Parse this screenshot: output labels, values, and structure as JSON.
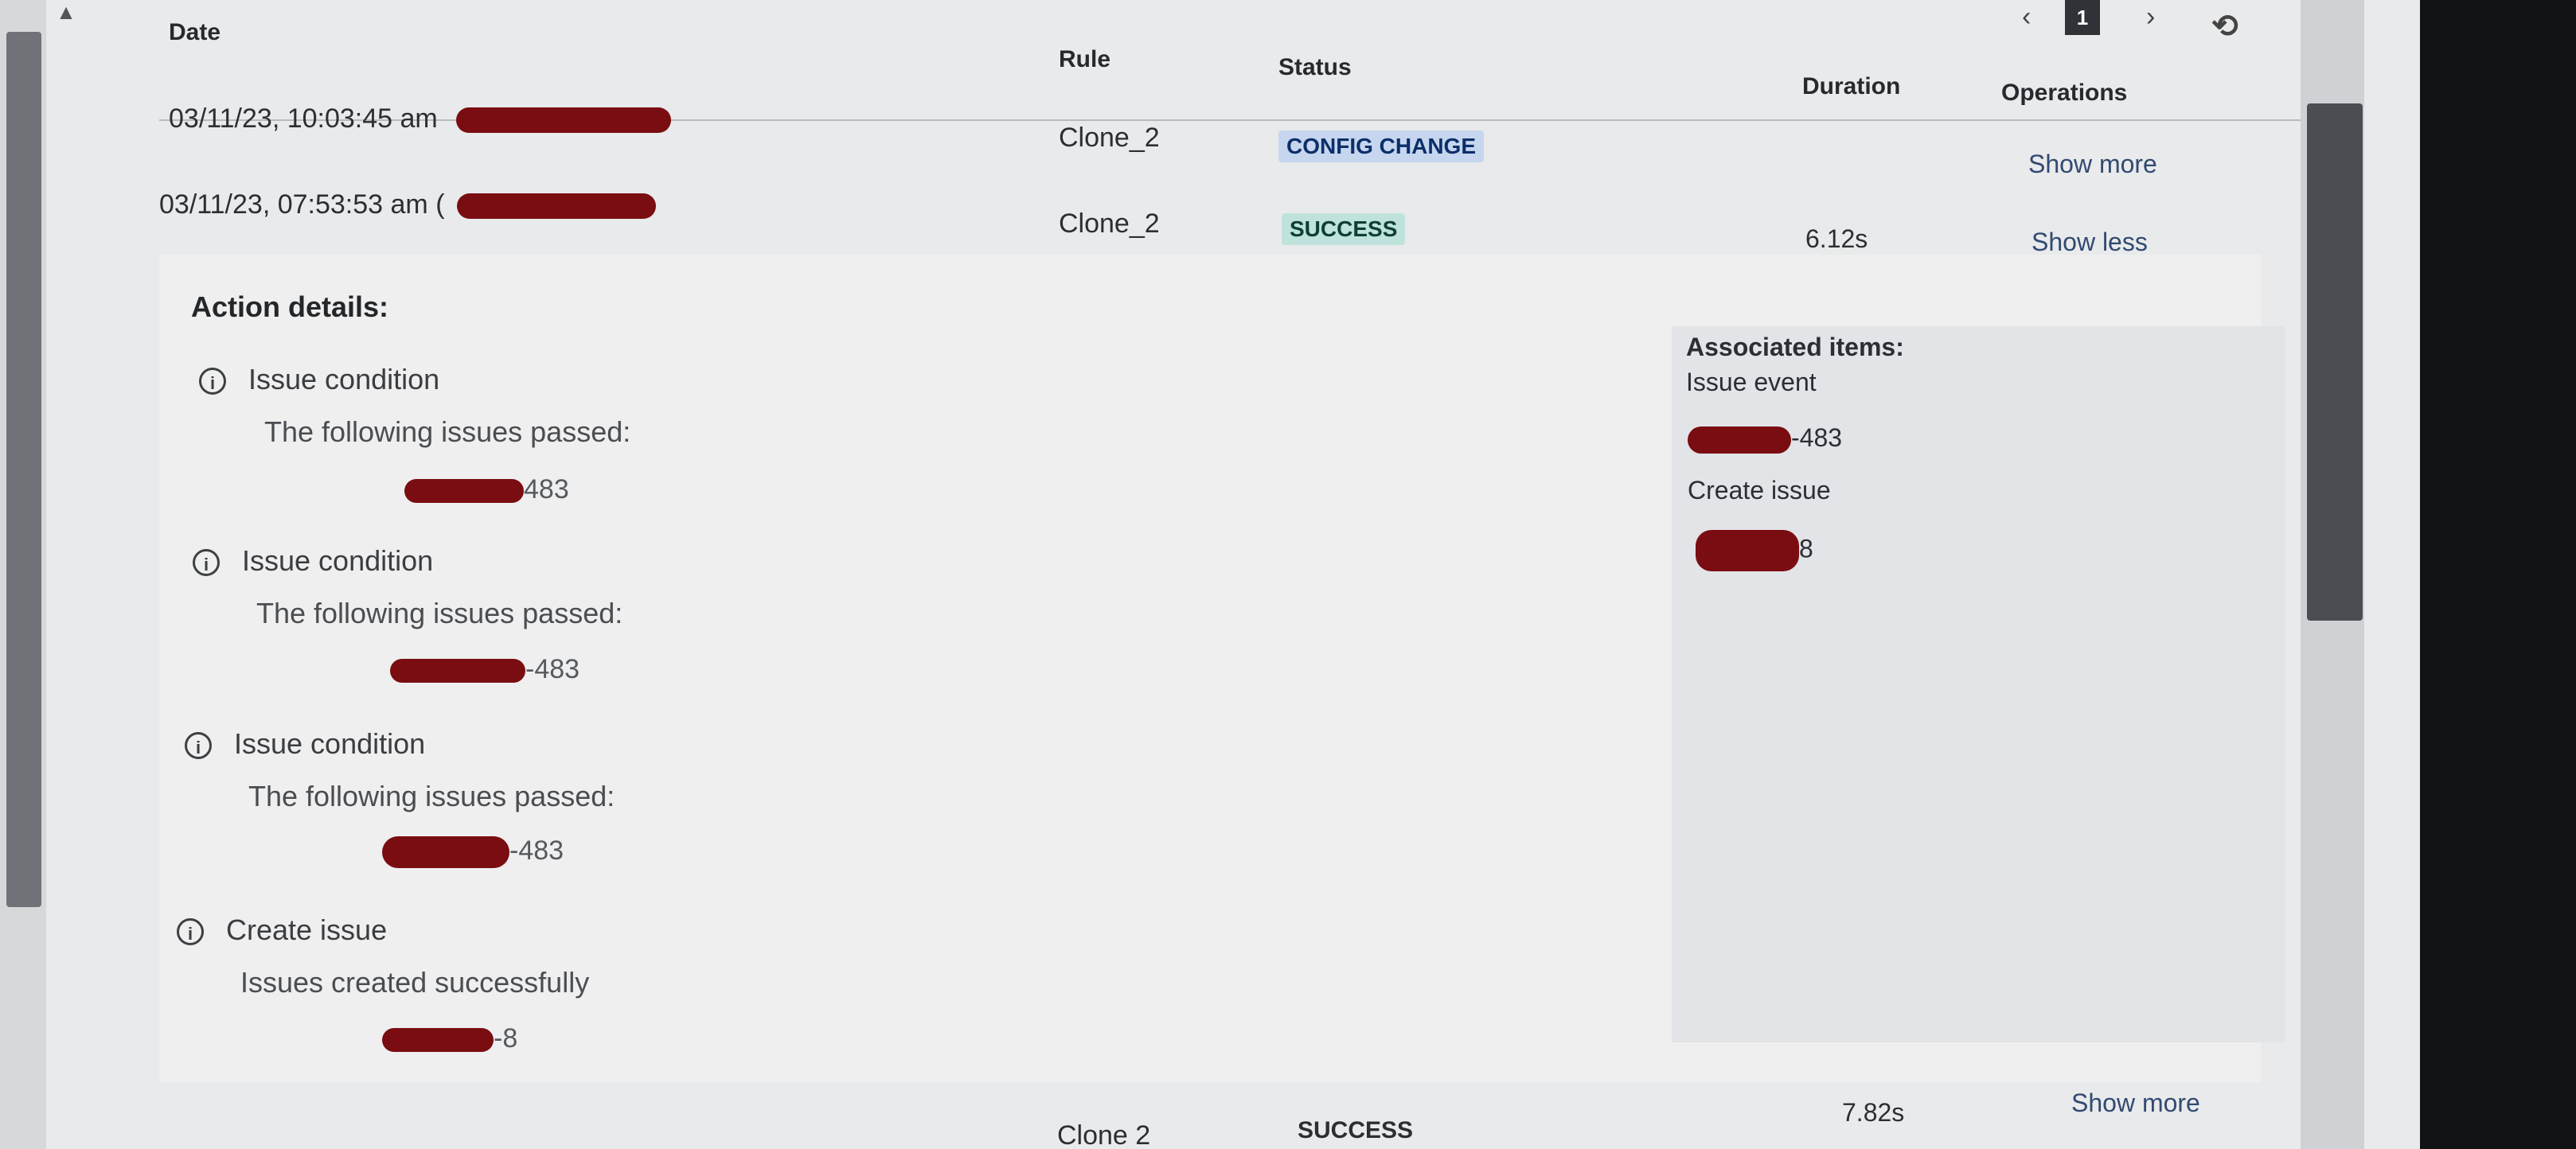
{
  "header": {
    "date": "Date",
    "rule": "Rule",
    "status": "Status",
    "duration": "Duration",
    "operations": "Operations"
  },
  "pagination": {
    "prev_icon": "chevron-left-icon",
    "current_page": "1",
    "next_icon": "chevron-right-icon",
    "refresh_icon": "refresh-icon"
  },
  "rows": [
    {
      "date": "03/11/23, 10:03:45 am",
      "rule": "Clone_2",
      "status": "CONFIG CHANGE",
      "duration": "",
      "operation": "Show more"
    },
    {
      "date": "03/11/23, 07:53:53 am (",
      "rule": "Clone_2",
      "status": "SUCCESS",
      "duration": "6.12s",
      "operation": "Show less"
    },
    {
      "date": "",
      "rule": "Clone 2",
      "status": "SUCCESS",
      "duration": "7.82s",
      "operation": "Show more"
    }
  ],
  "details": {
    "title": "Action details:",
    "steps": [
      {
        "title": "Issue condition",
        "message": "The following issues passed:",
        "issue": "483"
      },
      {
        "title": "Issue condition",
        "message": "The following issues passed:",
        "issue": "-483"
      },
      {
        "title": "Issue condition",
        "message": "The following issues passed:",
        "issue": "-483"
      },
      {
        "title": "Create issue",
        "message": "Issues created successfully",
        "issue": "-8"
      }
    ]
  },
  "associated": {
    "title": "Associated items:",
    "event_label": "Issue event",
    "event_issue": "-483",
    "create_label": "Create issue",
    "create_issue": "8"
  }
}
